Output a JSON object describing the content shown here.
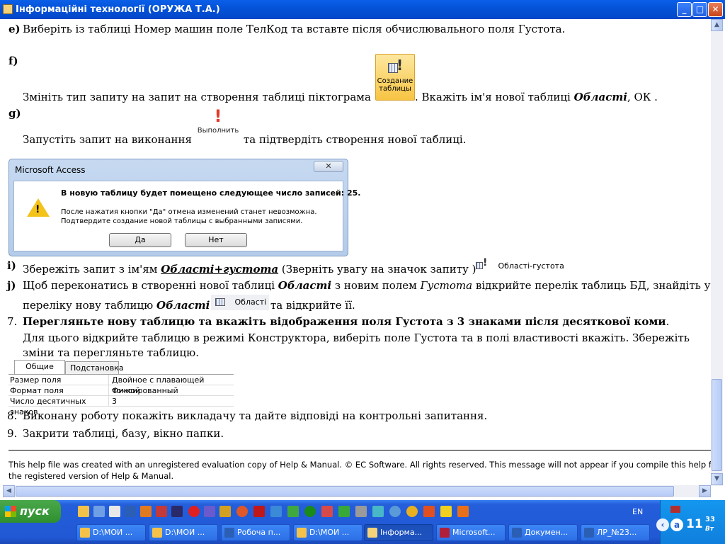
{
  "window": {
    "title": "Інформаційні технології (ОРУЖА Т.А.)",
    "minimize": "_",
    "maximize": "□",
    "close": "✕"
  },
  "doc": {
    "e_marker": "e)",
    "e_text": "Виберіть із таблиці Номер машин поле ТелКод та вставте після обчислювального поля Густота.",
    "f_marker": "f)",
    "f_text_a": "Змініть тип запиту на запит на створення таблиці  піктограма",
    "f_text_b": ". Вкажіть  ім'я нової таблиці",
    "f_text_c": "Області",
    "f_text_d": ", ОК .",
    "create_btn_line1": "Создание",
    "create_btn_line2": "таблицы",
    "g_marker": "g)",
    "g_text_a": "Запустіть запит на виконання",
    "g_text_b": "та підтвердіть створення нової таблиці.",
    "run_btn_label": "Выполнить",
    "dialog": {
      "title": "Microsoft Access",
      "close": "✕",
      "msg1": "В новую таблицу будет помещено следующее число записей: 25.",
      "msg2": "После нажатия кнопки \"Да\" отмена изменений станет невозможна.",
      "msg3": "Подтвердите создание новой таблицы с выбранными записями.",
      "yes": "Да",
      "no": "Нет"
    },
    "i_marker": "i)",
    "i_text_a": "Збережіть запит  з ім'ям",
    "i_text_b": "Області+густота",
    "i_text_c": "(Зверніть увагу на значок запиту )",
    "query_chip_label": "Області-густота",
    "j_marker": "j)",
    "j_text_a": "Щоб переконатись в створенні нової таблиці",
    "j_text_b": "Області",
    "j_text_c": "з новим полем",
    "j_text_d": "Густота",
    "j_text_e": "відкрийте перелік таблиць БД, знайдіть у",
    "j2_text_a": "переліку нову таблицю",
    "j2_text_b": "Області",
    "j2_text_c": "та відкрийте її.",
    "table_chip_label": "Області",
    "s7_marker": "7.",
    "s7_bold": "Перегляньте нову таблицю  та вкажіть відображення поля Густота з 3 знаками після десяткової коми",
    "s7_end": ".",
    "s7_line2": "Для цього відкрийте таблицю в режимі Конструктора, виберіть поле Густота та в полі властивості вкажіть. Збережіть",
    "s7_line3": "зміни та перегляньте таблицю.",
    "props": {
      "tab_general": "Общие",
      "tab_lookup": "Подстановка",
      "rows": [
        {
          "name": "Размер поля",
          "value": "Двойное с плавающей точкой"
        },
        {
          "name": "Формат поля",
          "value": "Фиксированный"
        },
        {
          "name": "Число десятичных знаков",
          "value": "3"
        }
      ]
    },
    "s8_marker": "8.",
    "s8_text": "Виконану роботу покажіть викладачу та дайте відповіді на контрольні запитання.",
    "s9_marker": "9.",
    "s9_text": "Закрити таблиці, базу, вікно папки.",
    "footer1": "This help file was created with an unregistered evaluation copy of Help & Manual. © EC Software. All rights reserved. This message will not appear if you compile this help fil",
    "footer2": "the registered version of Help & Manual."
  },
  "scroll": {
    "up": "▲",
    "down": "▼",
    "left": "◀",
    "right": "▶"
  },
  "taskbar": {
    "start_label": "пуск",
    "tasks": [
      {
        "label": "D:\\МОИ ..."
      },
      {
        "label": "D:\\МОИ ..."
      },
      {
        "label": "Робоча п..."
      },
      {
        "label": "D:\\МОИ ..."
      },
      {
        "label": "Інформа..."
      },
      {
        "label": "Microsoft..."
      },
      {
        "label": "Докумен..."
      },
      {
        "label": "ЛР_№23..."
      }
    ],
    "lang": "EN",
    "clock_hour": "11",
    "clock_min": "33",
    "clock_day": "Вт"
  }
}
